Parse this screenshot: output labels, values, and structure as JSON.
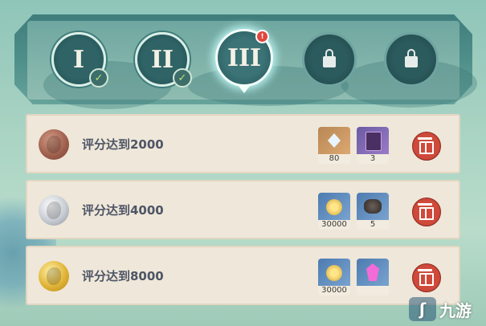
{
  "tiers": [
    {
      "numeral": "I",
      "status": "completed"
    },
    {
      "numeral": "II",
      "status": "completed"
    },
    {
      "numeral": "III",
      "status": "active",
      "alert": "!"
    },
    {
      "status": "locked"
    },
    {
      "status": "locked"
    }
  ],
  "rows": [
    {
      "medal": "bronze",
      "text": "评分达到2000",
      "rewards": [
        {
          "icon": "primogem-icon",
          "qty": "80"
        },
        {
          "icon": "purple-book-icon",
          "qty": "3"
        }
      ],
      "claim_icon": "gift-icon"
    },
    {
      "medal": "silver",
      "text": "评分达到4000",
      "rewards": [
        {
          "icon": "mora-coin-icon",
          "qty": "30000"
        },
        {
          "icon": "ore-icon",
          "qty": "5"
        }
      ],
      "claim_icon": "gift-icon"
    },
    {
      "medal": "gold",
      "text": "评分达到8000",
      "rewards": [
        {
          "icon": "mora-coin-icon",
          "qty": "30000"
        },
        {
          "icon": "crystal-icon",
          "qty": ""
        }
      ],
      "claim_icon": "gift-icon"
    }
  ],
  "watermark": {
    "text": "九游"
  },
  "colors": {
    "gift": "#cf4a3a",
    "check": "#b9e07a",
    "alert": "#e0473c"
  }
}
